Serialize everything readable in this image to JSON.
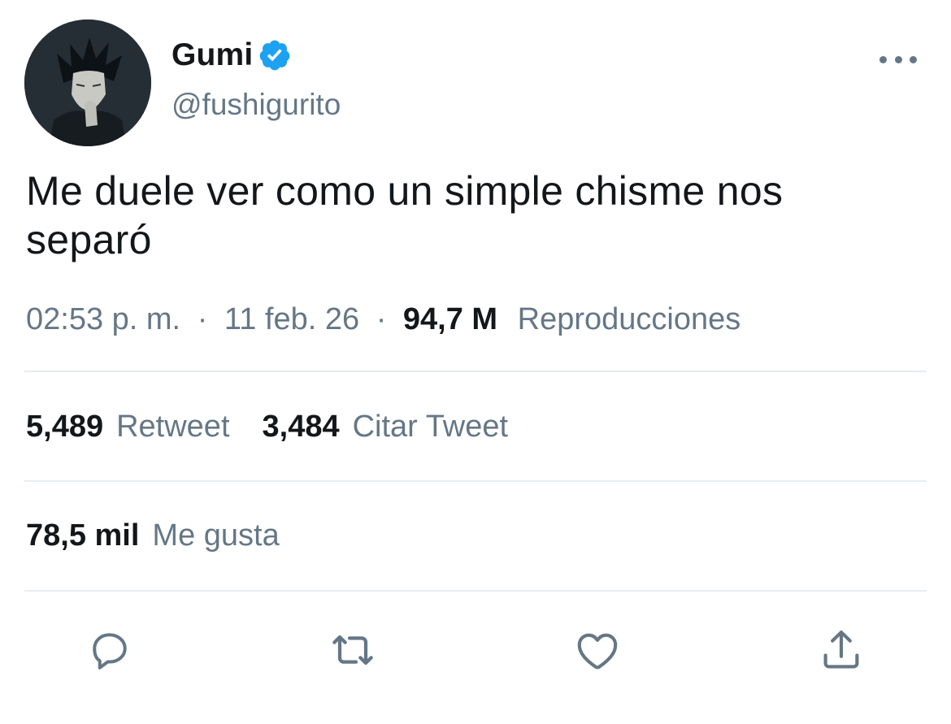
{
  "user": {
    "display_name": "Gumi",
    "handle": "@fushigurito",
    "verified": true,
    "verified_color": "#1da1f2"
  },
  "tweet": {
    "text": "Me duele ver como un simple chisme nos separó"
  },
  "meta": {
    "time": "02:53 p. m.",
    "separator": "·",
    "date": "11 feb. 26",
    "views_count": "94,7 M",
    "views_label": "Reproducciones"
  },
  "stats": {
    "retweets_count": "5,489",
    "retweets_label": "Retweet",
    "quotes_count": "3,484",
    "quotes_label": "Citar Tweet",
    "likes_count": "78,5 mil",
    "likes_label": "Me gusta"
  },
  "actions": [
    {
      "icon": "reply-icon"
    },
    {
      "icon": "retweet-icon"
    },
    {
      "icon": "like-icon"
    },
    {
      "icon": "share-icon"
    }
  ],
  "colors": {
    "text_primary": "#14171a",
    "text_secondary": "#657786",
    "divider": "#e6ecf0",
    "icon": "#657786"
  }
}
